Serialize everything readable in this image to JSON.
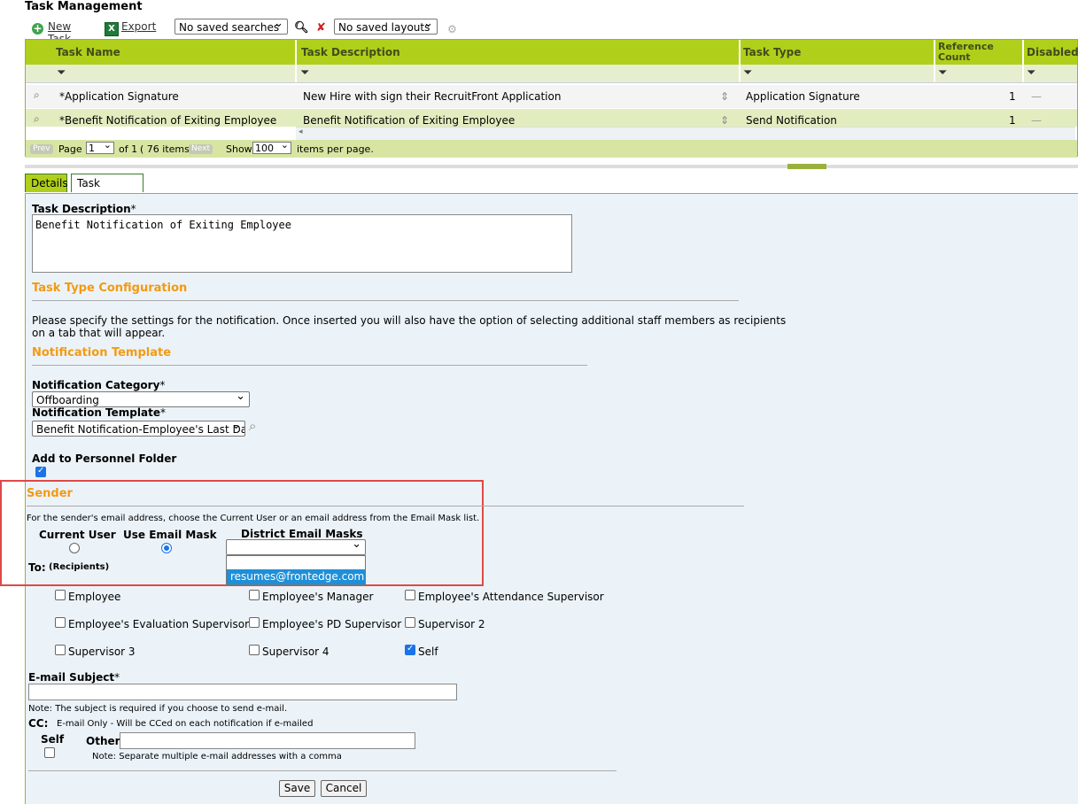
{
  "page_title": "Task Management",
  "toolbar": {
    "new_task": "New Task",
    "export": "Export",
    "saved_searches": "No saved searches",
    "saved_layouts": "No saved layouts"
  },
  "grid": {
    "headers": {
      "name": "Task Name",
      "description": "Task Description",
      "type": "Task Type",
      "ref_count_1": "Reference",
      "ref_count_2": "Count",
      "disabled": "Disabled"
    },
    "rows": [
      {
        "name": "*Application Signature",
        "description": "New Hire with sign their RecruitFront Application",
        "type": "Application Signature",
        "count": "1",
        "disabled": "—"
      },
      {
        "name": "*Benefit Notification of Exiting Employee",
        "description": "Benefit Notification of Exiting Employee",
        "type": "Send Notification",
        "count": "1",
        "disabled": "—"
      }
    ],
    "pager": {
      "prev": "Prev",
      "page_label": "Page",
      "page_value": "1",
      "of_text": "of 1",
      "items_text": "( 76  items)",
      "next": "Next",
      "show_label": "Show",
      "per_page_value": "100",
      "per_page_label": "items per page."
    }
  },
  "tabs": {
    "details": "Details",
    "profiles": "Task Profiles"
  },
  "form": {
    "task_description_label": "Task Description",
    "required_mark": "*",
    "task_description_value": "Benefit Notification of Exiting Employee",
    "config_heading": "Task Type Configuration",
    "config_note_line1": "Please specify the settings for the notification. Once inserted you will also have the option of selecting additional staff members as recipients",
    "config_note_line2": "on a tab that will appear.",
    "template_heading": "Notification Template",
    "category_label": "Notification Category",
    "category_value": "Offboarding",
    "template_label": "Notification Template",
    "template_value": "Benefit Notification-Employee's Last Day",
    "personnel_label": "Add to Personnel Folder",
    "personnel_checked": true,
    "sender_heading": "Sender",
    "sender_note": "For the sender's email address, choose the Current User or an email address from the Email Mask list.",
    "current_user_label": "Current User",
    "email_mask_label": "Use Email Mask",
    "district_masks_label": "District Email Masks",
    "district_mask_value": "",
    "dropdown_option": "resumes@frontedge.com",
    "to_label": "To:",
    "recipients_label": "(Recipients)",
    "recipients": [
      {
        "label": "Employee",
        "checked": false
      },
      {
        "label": "Employee's Manager",
        "checked": false
      },
      {
        "label": "Employee's Attendance Supervisor",
        "checked": false
      },
      {
        "label": "Employee's Evaluation Supervisor",
        "checked": false
      },
      {
        "label": "Employee's PD Supervisor",
        "checked": false
      },
      {
        "label": "Supervisor 2",
        "checked": false
      },
      {
        "label": "Supervisor 3",
        "checked": false
      },
      {
        "label": "Supervisor 4",
        "checked": false
      },
      {
        "label": "Self",
        "checked": true
      }
    ],
    "subject_label": "E-mail Subject",
    "subject_value": "",
    "subject_note": "Note: The subject is required if you choose to send e-mail.",
    "cc_label": "CC:",
    "cc_note": "E-mail Only - Will be CCed on each notification if e-mailed",
    "cc_self_label": "Self",
    "cc_other_label": "Other",
    "cc_other_value": "",
    "cc_other_note": "Note: Separate multiple e-mail addresses with a comma",
    "save": "Save",
    "cancel": "Cancel"
  },
  "colors": {
    "header_green": "#b0cf1a",
    "accent_orange": "#f39a12",
    "highlight_red": "#e04848",
    "select_blue": "#1e8fd8"
  }
}
